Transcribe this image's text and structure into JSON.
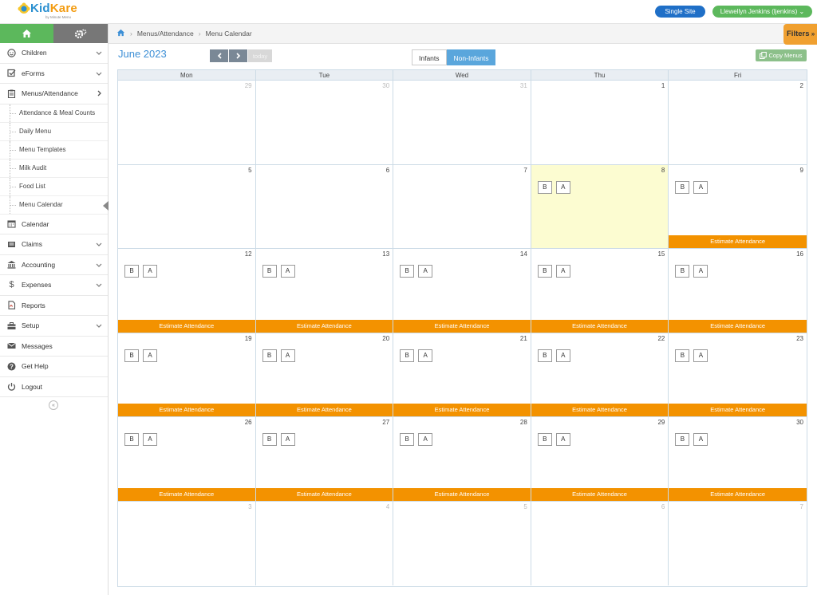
{
  "brand": {
    "name_a": "Kid",
    "name_b": "Kare",
    "sub": "by Minute Menu"
  },
  "topbar": {
    "site_button": "Single Site",
    "user_button": "Llewellyn Jenkins (ljenkins)"
  },
  "sidebar": {
    "items": [
      {
        "label": "Children",
        "icon": "child-face-icon"
      },
      {
        "label": "eForms",
        "icon": "checkbox-icon"
      },
      {
        "label": "Menus/Attendance",
        "icon": "clipboard-icon"
      },
      {
        "label": "Calendar",
        "icon": "calendar-icon"
      },
      {
        "label": "Claims",
        "icon": "claims-icon"
      },
      {
        "label": "Accounting",
        "icon": "bank-icon"
      },
      {
        "label": "Expenses",
        "icon": "dollar-icon"
      },
      {
        "label": "Reports",
        "icon": "pdf-icon"
      },
      {
        "label": "Setup",
        "icon": "toolbox-icon"
      },
      {
        "label": "Messages",
        "icon": "envelope-icon"
      },
      {
        "label": "Get Help",
        "icon": "help-icon"
      },
      {
        "label": "Logout",
        "icon": "power-icon"
      }
    ],
    "subitems": [
      "Attendance & Meal Counts",
      "Daily Menu",
      "Menu Templates",
      "Milk Audit",
      "Food List",
      "Menu Calendar"
    ]
  },
  "breadcrumb": {
    "part1": "Menus/Attendance",
    "part2": "Menu Calendar"
  },
  "filters_label": "Filters",
  "calendar": {
    "title": "June 2023",
    "today_label": "today",
    "tabs": [
      "Infants",
      "Non-Infants"
    ],
    "active_tab": "Non-Infants",
    "copy_label": "Copy Menus",
    "days": [
      "Mon",
      "Tue",
      "Wed",
      "Thu",
      "Fri"
    ],
    "meal_b": "B",
    "meal_a": "A",
    "estimate_label": "Estimate Attendance",
    "weeks": [
      [
        "29",
        "30",
        "31",
        "1",
        "2"
      ],
      [
        "5",
        "6",
        "7",
        "8",
        "9"
      ],
      [
        "12",
        "13",
        "14",
        "15",
        "16"
      ],
      [
        "19",
        "20",
        "21",
        "22",
        "23"
      ],
      [
        "26",
        "27",
        "28",
        "29",
        "30"
      ],
      [
        "3",
        "4",
        "5",
        "6",
        "7"
      ]
    ]
  },
  "colors": {
    "accent_blue": "#3d8fd6",
    "green": "#5cb85c",
    "orange": "#f39200",
    "today_bg": "#fcfcd1"
  }
}
